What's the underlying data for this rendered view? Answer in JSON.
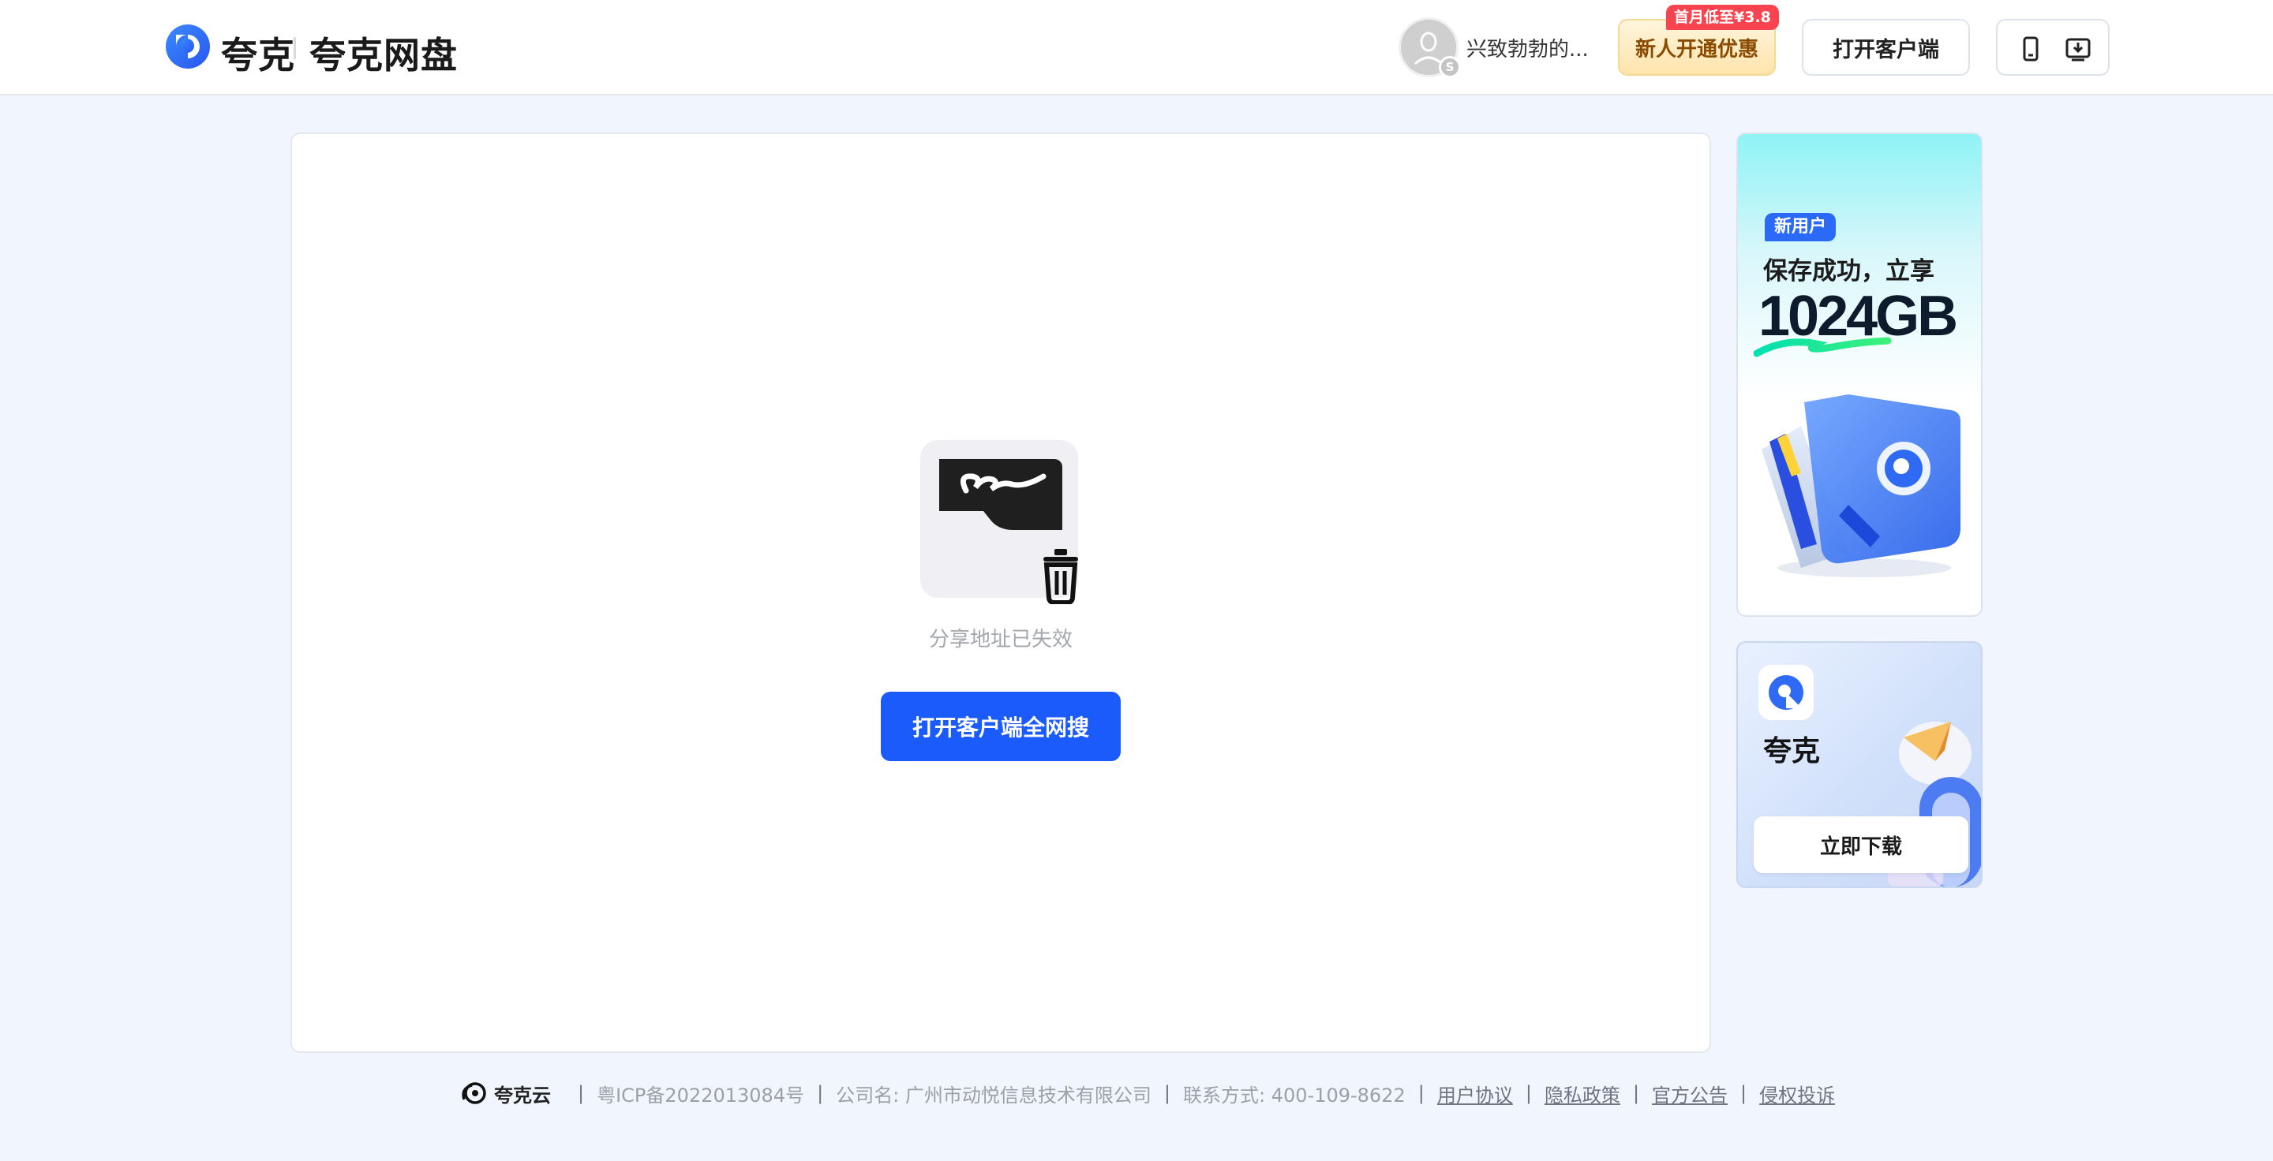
{
  "header": {
    "brand_short": "夸克",
    "brand_full": "夸克网盘",
    "username": "兴致勃勃的...",
    "vip_badge": "首月低至¥3.8",
    "vip_button": "新人开通优惠",
    "open_client_button": "打开客户端"
  },
  "main": {
    "empty_message": "分享地址已失效",
    "search_button": "打开客户端全网搜"
  },
  "ads": {
    "promo": {
      "tag": "新用户",
      "line1": "保存成功，立享",
      "big_text": "1024GB"
    },
    "download": {
      "app_name": "夸克",
      "button": "立即下载"
    }
  },
  "footer": {
    "brand": "夸克云",
    "icp": "粤ICP备2022013084号",
    "company": "公司名: 广州市动悦信息技术有限公司",
    "contact": "联系方式: 400-109-8622",
    "links": [
      "用户协议",
      "隐私政策",
      "官方公告",
      "侵权投诉"
    ]
  },
  "colors": {
    "primary": "#1c5bfb",
    "page_background": "#f1f6fe",
    "vip_gold": "#ffe3ac",
    "badge_red": "#f8444f"
  },
  "icons": [
    "quark-logo-icon",
    "mobile-icon",
    "download-icon",
    "trash-icon",
    "cloud-logo-icon"
  ]
}
